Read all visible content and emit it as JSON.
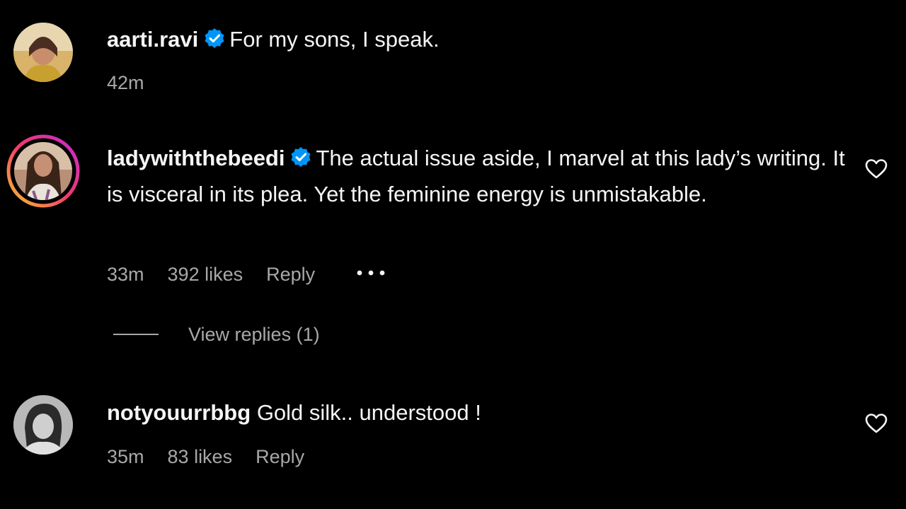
{
  "comments": [
    {
      "username": "aarti.ravi",
      "verified": true,
      "text": "For my sons, I speak.",
      "time": "42m"
    },
    {
      "username": "ladywiththebeedi",
      "verified": true,
      "text": "The actual issue aside, I marvel at this lady’s writing. It is visceral in its plea. Yet the feminine energy is unmistakable.",
      "time": "33m",
      "likes": "392 likes",
      "reply_label": "Reply",
      "more_label": "•••",
      "view_replies": "View replies (1)"
    },
    {
      "username": "notyouurrbbg",
      "verified": false,
      "text": "Gold silk.. understood !",
      "time": "35m",
      "likes": "83 likes",
      "reply_label": "Reply"
    }
  ],
  "colors": {
    "background": "#000000",
    "text": "#f5f5f5",
    "secondary": "#a8a8a8",
    "verified": "#0095f6"
  },
  "icons": {
    "verified": "verified-badge-icon",
    "like": "heart-outline-icon",
    "more": "more-options-icon"
  }
}
